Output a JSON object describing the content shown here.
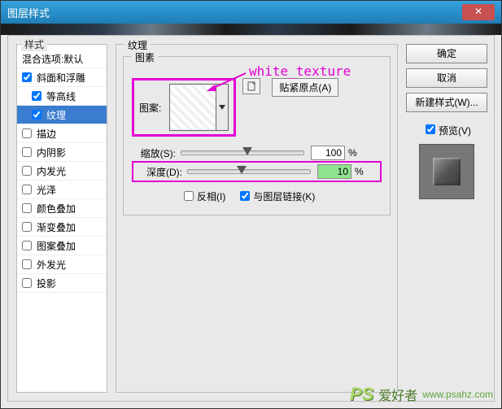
{
  "window": {
    "title": "图层样式"
  },
  "styles": {
    "header": "样式",
    "blend": "混合选项:默认",
    "items": [
      {
        "label": "斜面和浮雕",
        "checked": true,
        "sel": false,
        "sub": false
      },
      {
        "label": "等高线",
        "checked": true,
        "sel": false,
        "sub": true
      },
      {
        "label": "纹理",
        "checked": true,
        "sel": true,
        "sub": true
      },
      {
        "label": "描边",
        "checked": false,
        "sel": false,
        "sub": false
      },
      {
        "label": "内阴影",
        "checked": false,
        "sel": false,
        "sub": false
      },
      {
        "label": "内发光",
        "checked": false,
        "sel": false,
        "sub": false
      },
      {
        "label": "光泽",
        "checked": false,
        "sel": false,
        "sub": false
      },
      {
        "label": "颜色叠加",
        "checked": false,
        "sel": false,
        "sub": false
      },
      {
        "label": "渐变叠加",
        "checked": false,
        "sel": false,
        "sub": false
      },
      {
        "label": "图案叠加",
        "checked": false,
        "sel": false,
        "sub": false
      },
      {
        "label": "外发光",
        "checked": false,
        "sel": false,
        "sub": false
      },
      {
        "label": "投影",
        "checked": false,
        "sel": false,
        "sub": false
      }
    ]
  },
  "panel": {
    "group_title": "纹理",
    "sub_title": "图素",
    "pattern_label": "图案:",
    "snap_origin": "贴紧原点(A)",
    "scale": {
      "label": "缩放(S):",
      "value": "100",
      "pct": "%",
      "pos": 50
    },
    "depth": {
      "label": "深度(D):",
      "value": "10",
      "pct": "%",
      "pos": 40
    },
    "invert": "反相(I)",
    "link": "与图层链接(K)",
    "link_checked": true,
    "invert_checked": false
  },
  "buttons": {
    "ok": "确定",
    "cancel": "取消",
    "newstyle": "新建样式(W)...",
    "preview": "预览(V)"
  },
  "annotation": "white_texture",
  "watermark": {
    "logo": "PS",
    "cn": "爱好者",
    "url": "www.psahz.com"
  }
}
